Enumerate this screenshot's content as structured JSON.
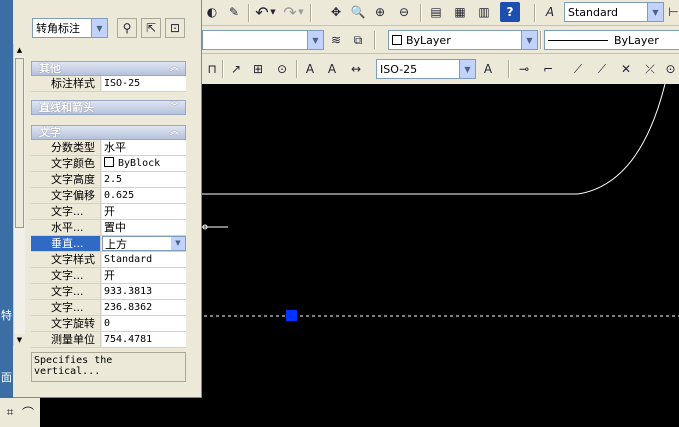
{
  "toolbar1": {
    "text_style_combo": "Standard"
  },
  "toolbar2": {
    "color_combo": "ByLayer",
    "linetype_combo": "ByLayer"
  },
  "toolbar3": {
    "dimstyle_combo": "ISO-25"
  },
  "palette": {
    "object_type_combo": "转角标注",
    "strip_texts": [
      "特",
      "面"
    ],
    "sections": [
      {
        "title": "其他"
      },
      {
        "title": "直线和箭头"
      },
      {
        "title": "文字"
      }
    ],
    "other_rows": [
      {
        "key": "标注样式",
        "value": "ISO-25"
      }
    ],
    "text_rows": [
      {
        "key": "分数类型",
        "value": "水平"
      },
      {
        "key": "文字颜色",
        "value": "ByBlock"
      },
      {
        "key": "文字高度",
        "value": "2.5"
      },
      {
        "key": "文字偏移",
        "value": "0.625"
      },
      {
        "key": "文字...",
        "value": "开"
      },
      {
        "key": "水平...",
        "value": "置中"
      },
      {
        "key": "垂直...",
        "value": "上方"
      },
      {
        "key": "文字样式",
        "value": "Standard"
      },
      {
        "key": "文字...",
        "value": "开"
      },
      {
        "key": "文字...",
        "value": "933.3813"
      },
      {
        "key": "文字...",
        "value": "236.8362"
      },
      {
        "key": "文字旋转",
        "value": "0"
      },
      {
        "key": "测量单位",
        "value": "754.4781"
      }
    ],
    "description": "Specifies the vertical..."
  },
  "colors": {
    "canvas": "#000000",
    "grip": "#0033ff",
    "selection": "#316ac5",
    "line": "#ffffff"
  }
}
